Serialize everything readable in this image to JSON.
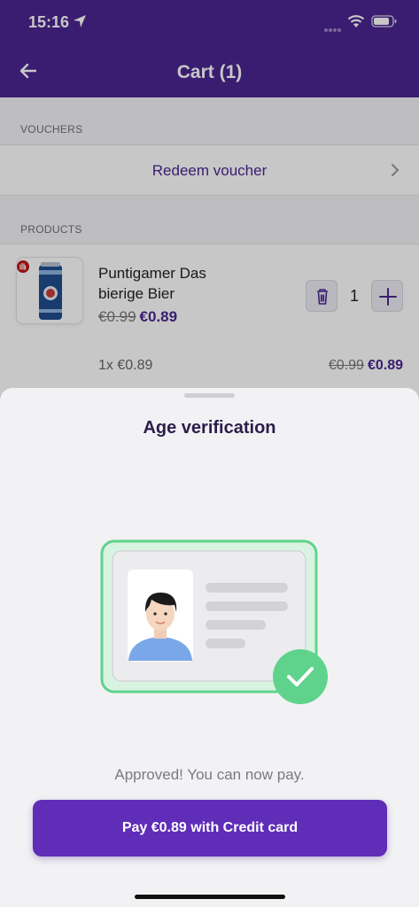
{
  "status_bar": {
    "time": "15:16"
  },
  "header": {
    "title": "Cart (1)"
  },
  "vouchers": {
    "section_label": "VOUCHERS",
    "redeem_label": "Redeem voucher"
  },
  "products": {
    "section_label": "PRODUCTS",
    "items": [
      {
        "name": "Puntigamer Das bierige Bier",
        "old_price": "€0.99",
        "new_price": "€0.89",
        "quantity": "1",
        "line_qty": "1x €0.89",
        "line_old_total": "€0.99",
        "line_new_total": "€0.89"
      }
    ]
  },
  "sheet": {
    "title": "Age verification",
    "message": "Approved! You can now pay.",
    "pay_button": "Pay €0.89 with Credit card"
  },
  "colors": {
    "brand": "#4b2691",
    "button": "#5f2db8",
    "success": "#5fd38b"
  },
  "icons": [
    "location-arrow-icon",
    "wifi-icon",
    "battery-icon",
    "back-arrow-icon",
    "chevron-right-icon",
    "age-restriction-icon",
    "trash-icon",
    "plus-icon",
    "checkmark-icon",
    "id-card-illustration"
  ]
}
